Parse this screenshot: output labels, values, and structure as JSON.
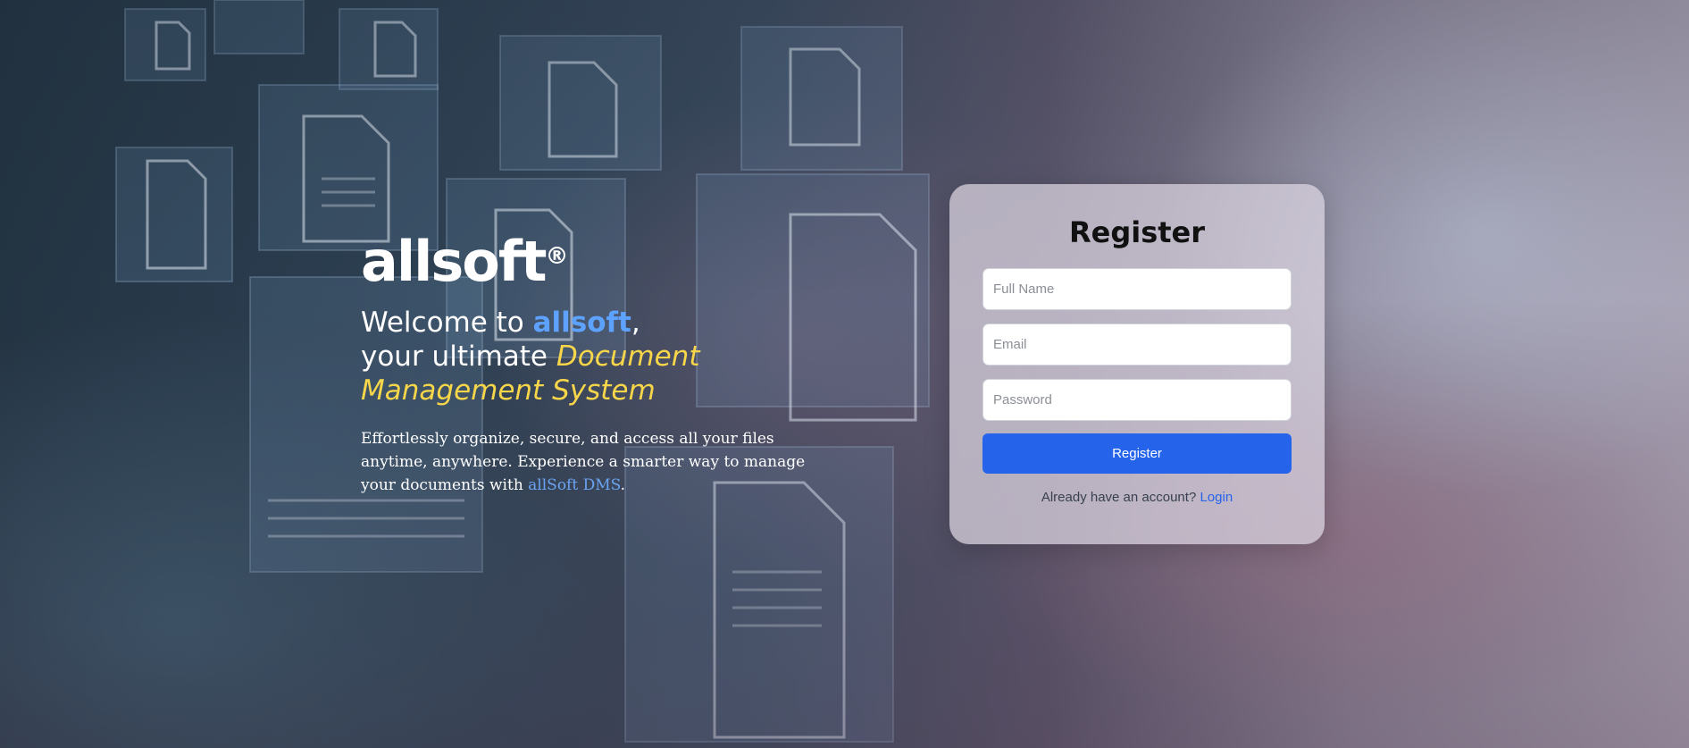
{
  "brand": {
    "logo": "allsoft",
    "registered_mark": "®"
  },
  "welcome": {
    "part1": "Welcome to ",
    "brand": "allsoft",
    "part2": ",",
    "part3": "your ultimate ",
    "highlight_line1": "Document",
    "highlight_line2": "Management System"
  },
  "description": {
    "text": "Effortlessly organize, secure, and access all your files anytime, anywhere. Experience a smarter way to manage your documents with ",
    "link": "allSoft DMS",
    "end": "."
  },
  "register_form": {
    "title": "Register",
    "full_name_placeholder": "Full Name",
    "email_placeholder": "Email",
    "password_placeholder": "Password",
    "submit_label": "Register",
    "login_prompt": "Already have an account? ",
    "login_link": "Login"
  },
  "colors": {
    "brand_blue": "#5ea2ff",
    "accent_yellow": "#f7d64a",
    "button_blue": "#2563eb"
  }
}
